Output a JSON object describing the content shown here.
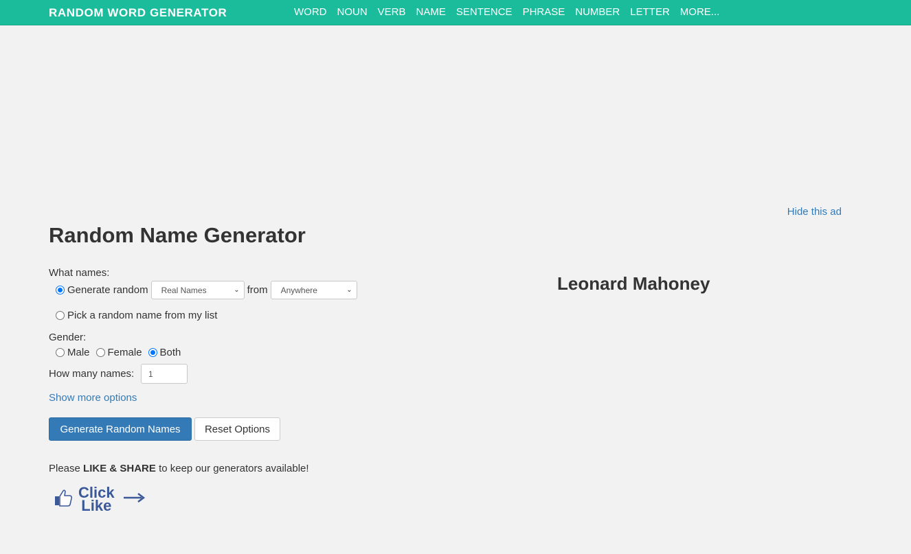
{
  "header": {
    "brand": "RANDOM WORD GENERATOR",
    "nav": [
      "WORD",
      "NOUN",
      "VERB",
      "NAME",
      "SENTENCE",
      "PHRASE",
      "NUMBER",
      "LETTER",
      "MORE..."
    ]
  },
  "ad": {
    "hide_label": "Hide this ad"
  },
  "page": {
    "title": "Random Name Generator"
  },
  "form": {
    "what_names_label": "What names:",
    "generate_random_label": "Generate random",
    "name_type_selected": "Real Names",
    "from_label": "from",
    "region_selected": "Anywhere",
    "pick_from_list_label": "Pick a random name from my list",
    "gender_label": "Gender:",
    "gender_options": [
      "Male",
      "Female",
      "Both"
    ],
    "gender_selected": "Both",
    "how_many_label": "How many names:",
    "how_many_value": "1",
    "show_more_label": "Show more options"
  },
  "buttons": {
    "generate": "Generate Random Names",
    "reset": "Reset Options"
  },
  "share": {
    "prefix": "Please",
    "emphasis": "LIKE & SHARE",
    "suffix": "to keep our generators available!",
    "click": "Click",
    "like": "Like"
  },
  "result": {
    "name": "Leonard Mahoney"
  },
  "colors": {
    "header_bg": "#1abc9c",
    "link": "#337ab7",
    "primary_button": "#337ab7",
    "like_blue": "#3b5998"
  }
}
